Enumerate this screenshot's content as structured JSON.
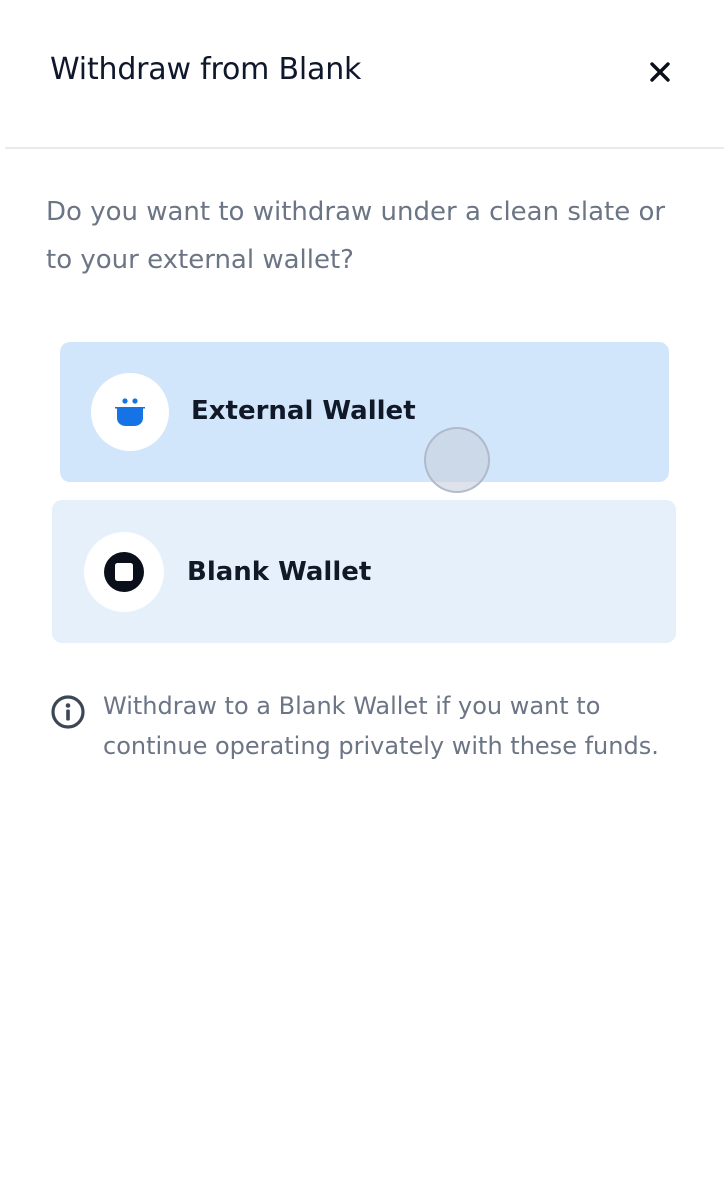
{
  "header": {
    "title": "Withdraw from Blank",
    "close_icon": "close-icon"
  },
  "prompt": {
    "question": "Do you want to withdraw under a clean slate or to your external wallet?"
  },
  "options": [
    {
      "label": "External Wallet",
      "icon": "wallet-icon",
      "background": "#d2e6fb",
      "icon_color": "#1673e6",
      "selected": true
    },
    {
      "label": "Blank Wallet",
      "icon": "blank-logo-icon",
      "background": "#e5f0fa",
      "icon_color": "#0b0f19",
      "selected": false
    }
  ],
  "info": {
    "icon": "info-icon",
    "text": "Withdraw to a Blank Wallet if you want to continue operating privately with these funds."
  },
  "colors": {
    "title": "#0f172a",
    "muted_text": "#6b7585",
    "accent": "#1673e6",
    "divider": "#e8eaed"
  }
}
